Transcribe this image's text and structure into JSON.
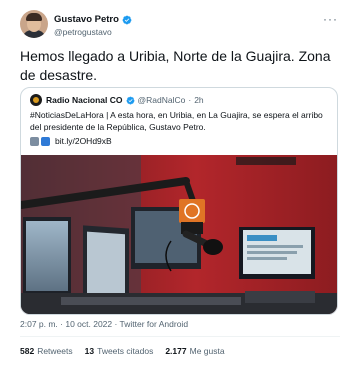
{
  "author": {
    "name": "Gustavo Petro",
    "handle": "@petrogustavo"
  },
  "tweet": {
    "text": "Hemos llegado a Uribia, Norte de la Guajira. Zona de desastre."
  },
  "quoted_tweet": {
    "name": "Radio Nacional CO",
    "handle": "@RadNalCo",
    "separator": "·",
    "time": "2h",
    "text": "#NoticiasDeLaHora | A esta hora, en Uribia, en La Guajira, se espera el arribo del presidente de la República, Gustavo Petro.",
    "link": "bit.ly/2OHd9xB",
    "image_description_icon": "radio-studio-microphone"
  },
  "meta": {
    "timestamp": "2:07 p. m. · 10 oct. 2022 · Twitter for Android"
  },
  "stats": {
    "retweets_count": "582",
    "retweets_label": "Retweets",
    "quotes_count": "13",
    "quotes_label": "Tweets citados",
    "likes_count": "2.177",
    "likes_label": "Me gusta"
  },
  "colors": {
    "verified": "#1d9bf0",
    "text": "#0f1419",
    "secondary": "#536471",
    "border": "#cfd9de"
  }
}
